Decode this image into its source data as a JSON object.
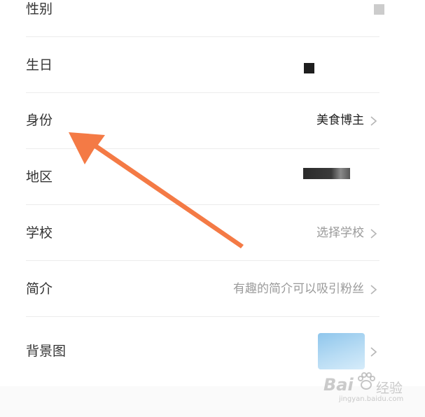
{
  "rows": [
    {
      "label": "性别"
    },
    {
      "label": "生日"
    },
    {
      "label": "身份",
      "value": "美食博主"
    },
    {
      "label": "地区"
    },
    {
      "label": "学校",
      "value": "选择学校"
    },
    {
      "label": "简介",
      "value": "有趣的简介可以吸引粉丝"
    },
    {
      "label": "背景图"
    }
  ],
  "watermark": {
    "brand": "Bai",
    "brand2": "经验",
    "url": "jingyan.baidu.com"
  },
  "colors": {
    "arrow": "#f47a45",
    "divider": "#ececec",
    "hint_text": "#9a9a9a"
  },
  "icons": [
    "chevron-right-icon",
    "annotation-arrow",
    "baidu-paw-icon"
  ]
}
